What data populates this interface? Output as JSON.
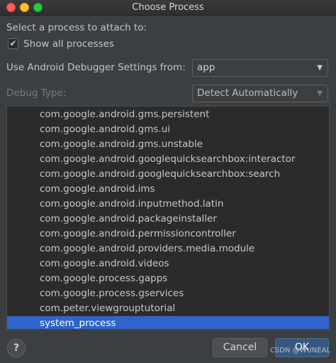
{
  "window": {
    "title": "Choose Process"
  },
  "prompt": "Select a process to attach to:",
  "show_all": {
    "label": "Show all processes",
    "checked": true,
    "check_glyph": "✔"
  },
  "debugger_settings": {
    "label": "Use Android Debugger Settings from:",
    "value": "app"
  },
  "debug_type": {
    "label": "Debug Type:",
    "value": "Detect Automatically"
  },
  "processes": [
    "com.google.android.gms.persistent",
    "com.google.android.gms.ui",
    "com.google.android.gms.unstable",
    "com.google.android.googlequicksearchbox:interactor",
    "com.google.android.googlequicksearchbox:search",
    "com.google.android.ims",
    "com.google.android.inputmethod.latin",
    "com.google.android.packageinstaller",
    "com.google.android.permissioncontroller",
    "com.google.android.providers.media.module",
    "com.google.android.videos",
    "com.google.process.gapps",
    "com.google.process.gservices",
    "com.peter.viewgrouptutorial",
    "system_process"
  ],
  "selected_process": "system_process",
  "buttons": {
    "help": "?",
    "cancel": "Cancel",
    "ok": "OK"
  },
  "watermark": "CSDN @WUNEAL",
  "icons": {
    "dropdown": "▼"
  },
  "colors": {
    "selection": "#2f65ca",
    "ok_button": "#365880"
  }
}
